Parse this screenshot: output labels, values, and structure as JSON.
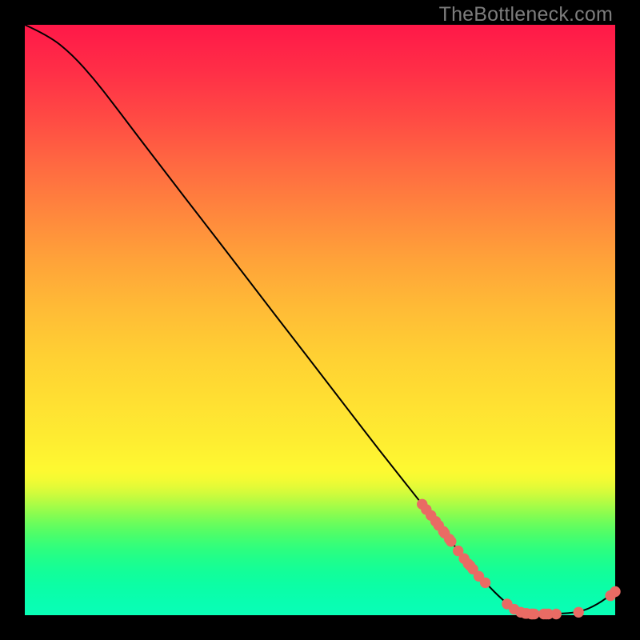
{
  "watermark": "TheBottleneck.com",
  "chart_data": {
    "type": "line",
    "title": "",
    "xlabel": "",
    "ylabel": "",
    "xlim": [
      0,
      100
    ],
    "ylim": [
      0,
      100
    ],
    "background_gradient": {
      "orientation": "vertical",
      "stops": [
        {
          "pos": 0,
          "color": "#ff1848"
        },
        {
          "pos": 50,
          "color": "#ffc034"
        },
        {
          "pos": 75,
          "color": "#fef931"
        },
        {
          "pos": 100,
          "color": "#09feb6"
        }
      ]
    },
    "curve": [
      {
        "x": 0.0,
        "y": 100.0
      },
      {
        "x": 4.0,
        "y": 98.2
      },
      {
        "x": 8.0,
        "y": 95.0
      },
      {
        "x": 12.0,
        "y": 90.5
      },
      {
        "x": 16.0,
        "y": 85.3
      },
      {
        "x": 20.0,
        "y": 80.0
      },
      {
        "x": 25.0,
        "y": 73.5
      },
      {
        "x": 30.0,
        "y": 67.0
      },
      {
        "x": 35.0,
        "y": 60.5
      },
      {
        "x": 40.0,
        "y": 54.0
      },
      {
        "x": 45.0,
        "y": 47.5
      },
      {
        "x": 50.0,
        "y": 41.0
      },
      {
        "x": 55.0,
        "y": 34.5
      },
      {
        "x": 60.0,
        "y": 28.0
      },
      {
        "x": 65.0,
        "y": 21.7
      },
      {
        "x": 70.0,
        "y": 15.4
      },
      {
        "x": 74.0,
        "y": 10.1
      },
      {
        "x": 78.0,
        "y": 5.5
      },
      {
        "x": 81.0,
        "y": 2.5
      },
      {
        "x": 83.0,
        "y": 1.0
      },
      {
        "x": 85.0,
        "y": 0.3
      },
      {
        "x": 90.0,
        "y": 0.2
      },
      {
        "x": 94.0,
        "y": 0.5
      },
      {
        "x": 97.0,
        "y": 1.8
      },
      {
        "x": 100.0,
        "y": 4.0
      }
    ],
    "scatter": [
      {
        "x": 67.3,
        "y": 18.8
      },
      {
        "x": 68.0,
        "y": 17.9
      },
      {
        "x": 68.8,
        "y": 16.9
      },
      {
        "x": 69.6,
        "y": 15.9
      },
      {
        "x": 70.1,
        "y": 15.2
      },
      {
        "x": 70.9,
        "y": 14.2
      },
      {
        "x": 71.1,
        "y": 13.9
      },
      {
        "x": 71.9,
        "y": 12.9
      },
      {
        "x": 72.2,
        "y": 12.5
      },
      {
        "x": 73.4,
        "y": 10.9
      },
      {
        "x": 74.4,
        "y": 9.6
      },
      {
        "x": 75.1,
        "y": 8.7
      },
      {
        "x": 75.4,
        "y": 8.4
      },
      {
        "x": 75.9,
        "y": 7.8
      },
      {
        "x": 76.9,
        "y": 6.6
      },
      {
        "x": 78.0,
        "y": 5.5
      },
      {
        "x": 81.7,
        "y": 1.9
      },
      {
        "x": 82.9,
        "y": 1.0
      },
      {
        "x": 84.0,
        "y": 0.5
      },
      {
        "x": 84.8,
        "y": 0.3
      },
      {
        "x": 85.0,
        "y": 0.3
      },
      {
        "x": 85.8,
        "y": 0.2
      },
      {
        "x": 86.0,
        "y": 0.2
      },
      {
        "x": 86.3,
        "y": 0.2
      },
      {
        "x": 87.9,
        "y": 0.2
      },
      {
        "x": 88.3,
        "y": 0.2
      },
      {
        "x": 88.7,
        "y": 0.2
      },
      {
        "x": 90.0,
        "y": 0.2
      },
      {
        "x": 93.8,
        "y": 0.5
      },
      {
        "x": 99.2,
        "y": 3.3
      },
      {
        "x": 100.0,
        "y": 4.0
      }
    ],
    "styles": {
      "line_color": "#000000",
      "line_width": 2,
      "marker_color": "#e96b64",
      "marker_radius_px": 6.7
    }
  }
}
